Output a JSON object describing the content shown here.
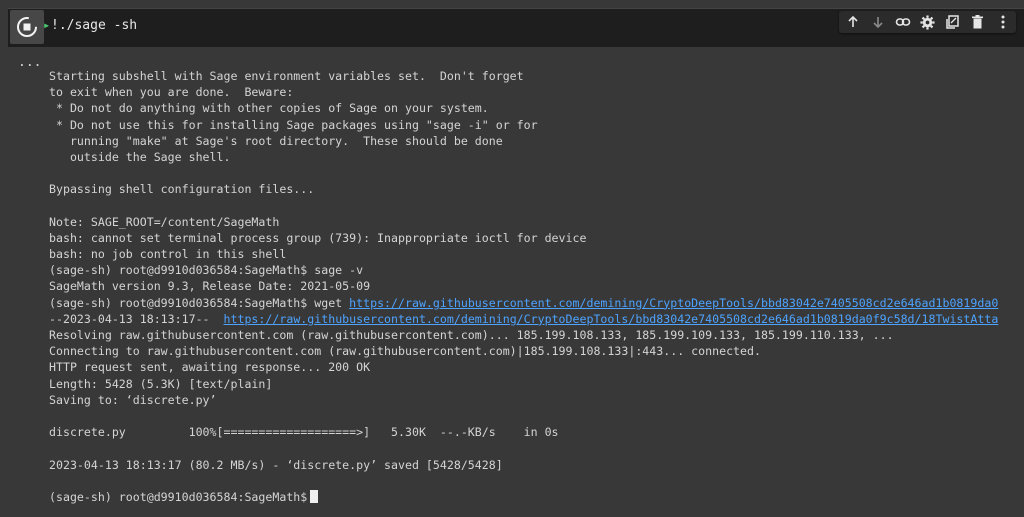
{
  "cell": {
    "code": "!./sage -sh",
    "output_indicator": "...",
    "run_icon": "stop-circle-icon"
  },
  "toolbar": {
    "icons": [
      "arrow-up-icon",
      "arrow-down-icon",
      "link-icon",
      "gear-icon",
      "mirror-cell-icon",
      "trash-icon",
      "more-vert-icon"
    ]
  },
  "output": {
    "lines": [
      "Starting subshell with Sage environment variables set.  Don't forget",
      "to exit when you are done.  Beware:",
      " * Do not do anything with other copies of Sage on your system.",
      " * Do not use this for installing Sage packages using \"sage -i\" or for",
      "   running \"make\" at Sage's root directory.  These should be done",
      "   outside the Sage shell.",
      "",
      "Bypassing shell configuration files...",
      "",
      "Note: SAGE_ROOT=/content/SageMath",
      "bash: cannot set terminal process group (739): Inappropriate ioctl for device",
      "bash: no job control in this shell",
      "(sage-sh) root@d9910d036584:SageMath$ sage -v",
      "SageMath version 9.3, Release Date: 2021-05-09"
    ],
    "wget_prefix": "(sage-sh) root@d9910d036584:SageMath$ wget ",
    "wget_url": "https://raw.githubusercontent.com/demining/CryptoDeepTools/bbd83042e7405508cd2e646ad1b0819da0",
    "date_prefix": "--2023-04-13 18:13:17--  ",
    "date_url": "https://raw.githubusercontent.com/demining/CryptoDeepTools/bbd83042e7405508cd2e646ad1b0819da0f9c58d/18TwistAtta",
    "lines2": [
      "Resolving raw.githubusercontent.com (raw.githubusercontent.com)... 185.199.108.133, 185.199.109.133, 185.199.110.133, ...",
      "Connecting to raw.githubusercontent.com (raw.githubusercontent.com)|185.199.108.133|:443... connected.",
      "HTTP request sent, awaiting response... 200 OK",
      "Length: 5428 (5.3K) [text/plain]",
      "Saving to: ‘discrete.py’",
      "",
      "discrete.py         100%[===================>]   5.30K  --.-KB/s    in 0s",
      "",
      "2023-04-13 18:13:17 (80.2 MB/s) - ‘discrete.py’ saved [5428/5428]",
      ""
    ],
    "prompt": "(sage-sh) root@d9910d036584:SageMath$"
  },
  "colors": {
    "background": "#383838",
    "cell_bg": "#1e1e1e",
    "text": "#d4d4d4",
    "link": "#4da3ff",
    "exec_green": "#4ecb71"
  }
}
